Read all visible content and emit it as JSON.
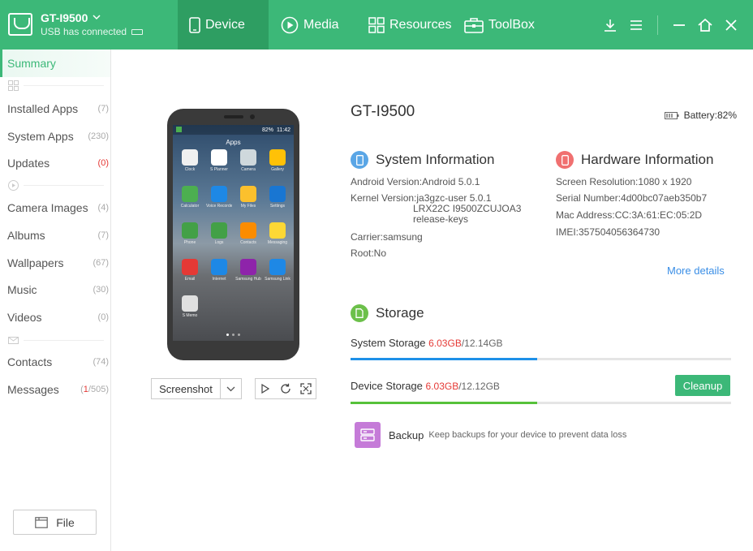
{
  "header": {
    "device_name": "GT-I9500",
    "usb_status": "USB has connected",
    "tabs": [
      {
        "label": "Device",
        "icon": "phone-icon",
        "active": true
      },
      {
        "label": "Media",
        "icon": "play-circle-icon",
        "active": false
      },
      {
        "label": "Resources",
        "icon": "grid-icon",
        "active": false
      },
      {
        "label": "ToolBox",
        "icon": "toolbox-icon",
        "active": false
      }
    ]
  },
  "sidebar": {
    "items": [
      {
        "label": "Summary",
        "count": ""
      },
      {
        "label": "Installed Apps",
        "count": "(7)"
      },
      {
        "label": "System Apps",
        "count": "(230)"
      },
      {
        "label": "Updates",
        "count": "(0)"
      },
      {
        "label": "Camera Images",
        "count": "(4)"
      },
      {
        "label": "Albums",
        "count": "(7)"
      },
      {
        "label": "Wallpapers",
        "count": "(67)"
      },
      {
        "label": "Music",
        "count": "(30)"
      },
      {
        "label": "Videos",
        "count": "(0)"
      },
      {
        "label": "Contacts",
        "count": "(74)"
      },
      {
        "label": "Messages",
        "count_unread": "1",
        "count_total": "/505)",
        "count_open": "("
      }
    ],
    "file_button": "File"
  },
  "phone": {
    "status_time": "11:42",
    "status_battery": "82%",
    "apps_title": "Apps",
    "apps": [
      {
        "label": "Clock",
        "color": "#f0f0f0"
      },
      {
        "label": "S Planner",
        "color": "#ffffff"
      },
      {
        "label": "Camera",
        "color": "#cfd8dc"
      },
      {
        "label": "Gallery",
        "color": "#ffc107"
      },
      {
        "label": "Calculator",
        "color": "#4caf50"
      },
      {
        "label": "Voice Recorder",
        "color": "#1e88e5"
      },
      {
        "label": "My Files",
        "color": "#fbc02d"
      },
      {
        "label": "Settings",
        "color": "#1976d2"
      },
      {
        "label": "Phone",
        "color": "#43a047"
      },
      {
        "label": "Logs",
        "color": "#43a047"
      },
      {
        "label": "Contacts",
        "color": "#fb8c00"
      },
      {
        "label": "Messaging",
        "color": "#fdd835"
      },
      {
        "label": "Email",
        "color": "#e53935"
      },
      {
        "label": "Internet",
        "color": "#1e88e5"
      },
      {
        "label": "Samsung Hub",
        "color": "#8e24aa"
      },
      {
        "label": "Samsung Link",
        "color": "#1e88e5"
      },
      {
        "label": "S Memo",
        "color": "#e0e0e0"
      }
    ]
  },
  "controls": {
    "screenshot_label": "Screenshot"
  },
  "device": {
    "title": "GT-I9500",
    "battery": "Battery:82%"
  },
  "system_info": {
    "heading": "System Information",
    "android_version": "Android Version:Android 5.0.1",
    "kernel_version_l1": "Kernel Version:ja3gzc-user 5.0.1",
    "kernel_version_l2": "LRX22C I9500ZCUJOA3",
    "kernel_version_l3": "release-keys",
    "carrier": "Carrier:samsung",
    "root": "Root:No"
  },
  "hardware_info": {
    "heading": "Hardware Information",
    "resolution": "Screen Resolution:1080 x 1920",
    "serial": "Serial Number:4d00bc07aeb350b7",
    "mac": "Mac Address:CC:3A:61:EC:05:2D",
    "imei": "IMEI:357504056364730",
    "more_details": "More details"
  },
  "storage": {
    "heading": "Storage",
    "system_label": "System Storage",
    "system_used": "6.03GB",
    "system_total": "/12.14GB",
    "system_fraction": 0.49,
    "device_label": "Device Storage",
    "device_used": "6.03GB",
    "device_total": "/12.12GB",
    "device_fraction": 0.49,
    "cleanup_label": "Cleanup"
  },
  "backup": {
    "title": "Backup",
    "description": "Keep backups for your device to prevent data loss"
  },
  "colors": {
    "brand": "#3cb878",
    "system_bar": "#1e90e8",
    "device_bar": "#56c13a",
    "sys_icon": "#5aa6e6",
    "hw_icon": "#f07070",
    "storage_icon": "#6cc04a",
    "used_red": "#e53935"
  }
}
